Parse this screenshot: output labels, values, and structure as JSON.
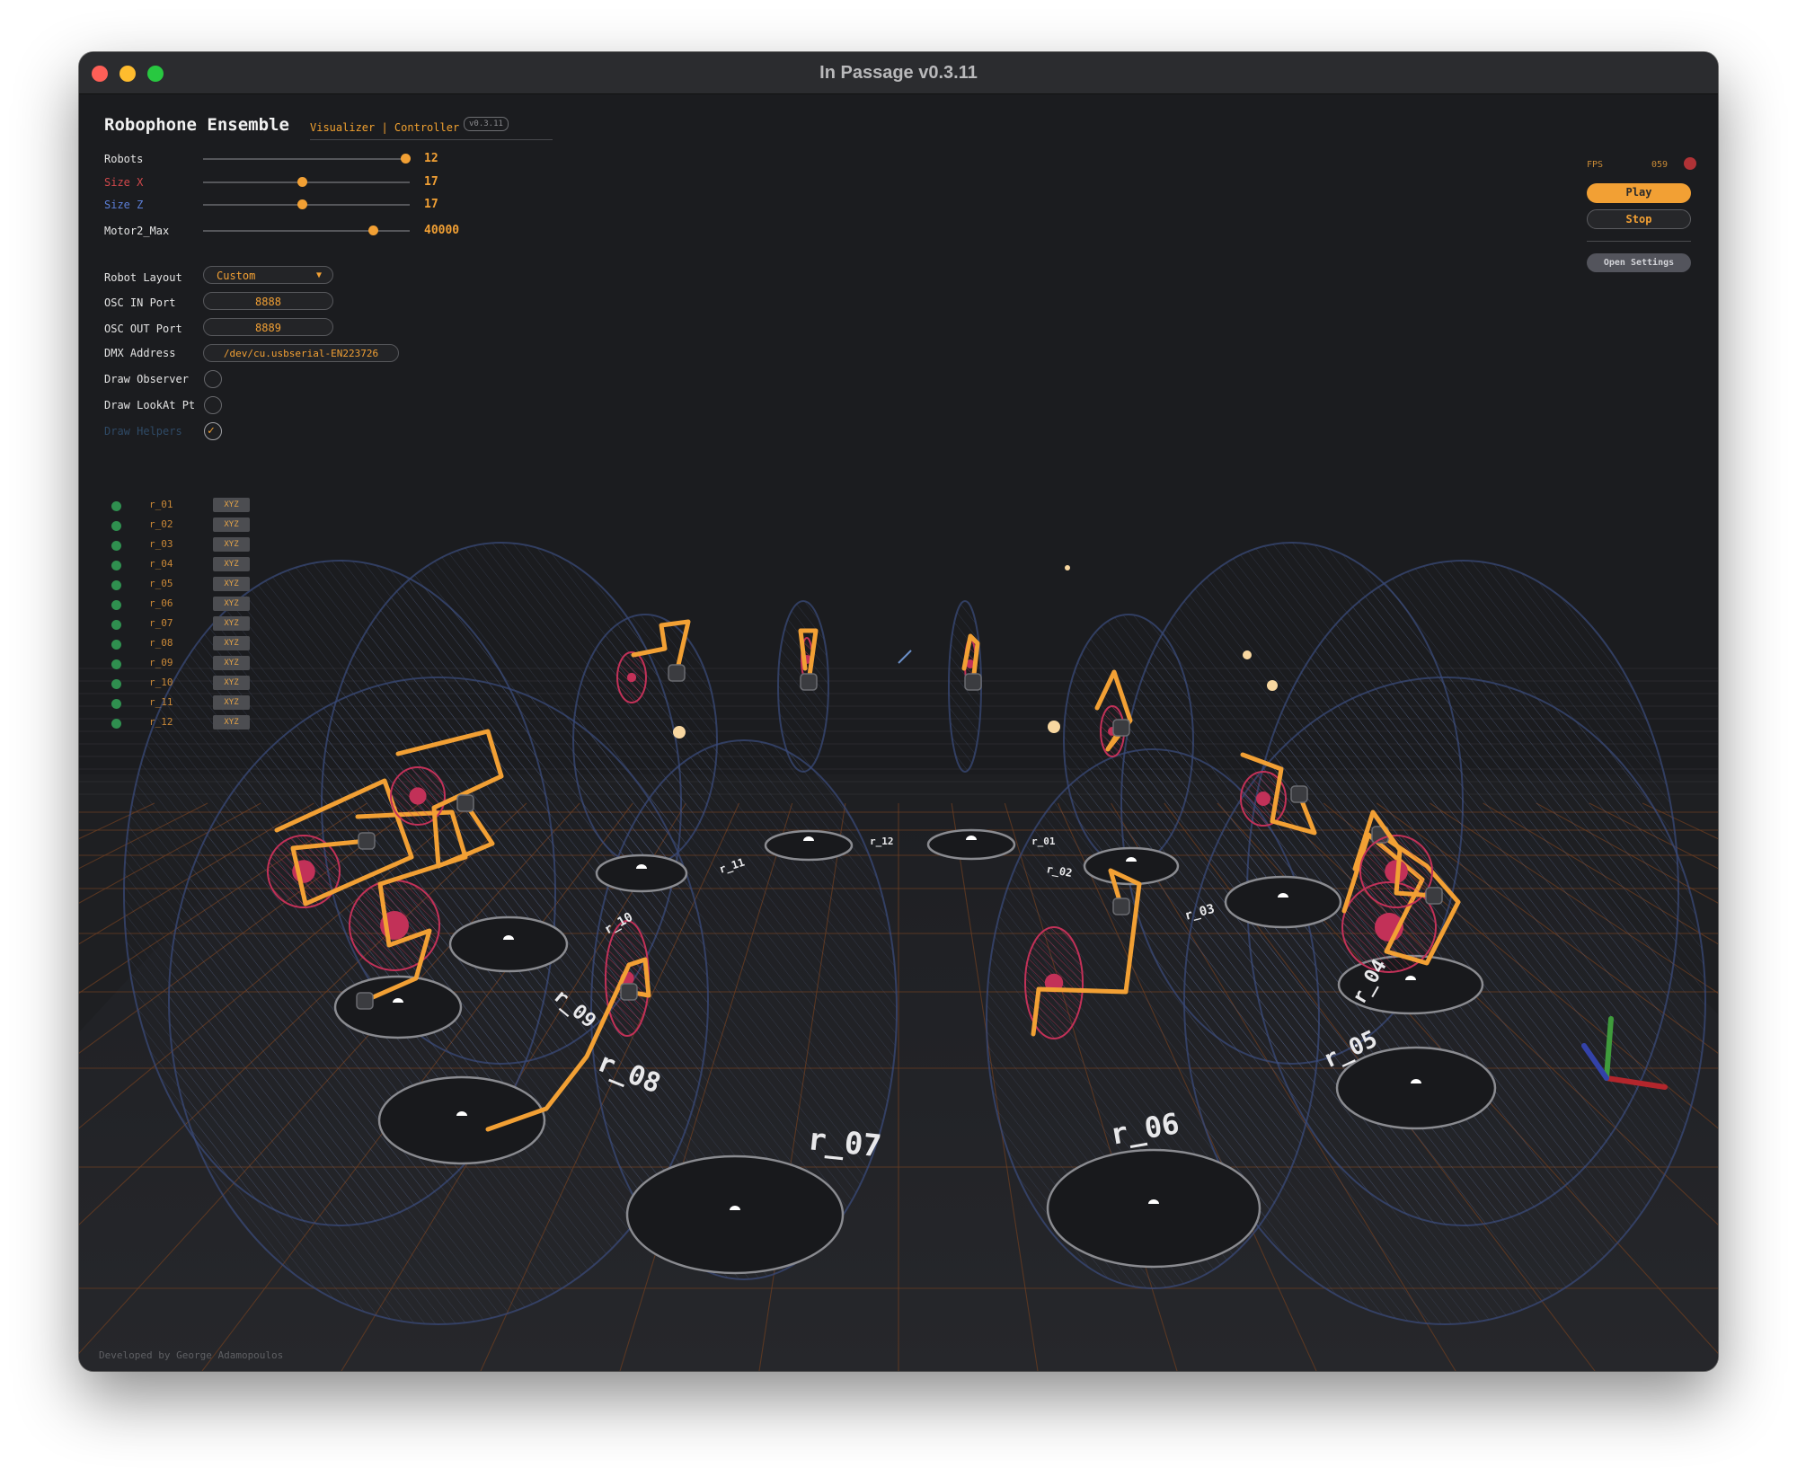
{
  "window": {
    "title": "In Passage v0.3.11"
  },
  "panel": {
    "title": "Robophone Ensemble",
    "subtitle": "Visualizer | Controller",
    "version": "v0.3.11",
    "sliders": [
      {
        "label": "Robots",
        "value": "12",
        "fraction": 0.98,
        "label_color": "#e4e4e4"
      },
      {
        "label": "Size X",
        "value": "17",
        "fraction": 0.48,
        "label_color": "#d0484b"
      },
      {
        "label": "Size Z",
        "value": "17",
        "fraction": 0.48,
        "label_color": "#5c7fd8"
      },
      {
        "label": "Motor2_Max",
        "value": "40000",
        "fraction": 0.82,
        "label_color": "#e4e4e4"
      }
    ],
    "layout": {
      "label": "Robot Layout",
      "value": "Custom"
    },
    "osc_in": {
      "label": "OSC IN Port",
      "value": "8888"
    },
    "osc_out": {
      "label": "OSC OUT Port",
      "value": "8889"
    },
    "dmx": {
      "label": "DMX Address",
      "value": "/dev/cu.usbserial-EN223726"
    },
    "toggles": [
      {
        "label": "Draw Observer",
        "checked": false,
        "label_color": "#e4e4e4"
      },
      {
        "label": "Draw LookAt Pt",
        "checked": false,
        "label_color": "#e4e4e4"
      },
      {
        "label": "Draw Helpers",
        "checked": true,
        "label_color": "#2f4a66"
      }
    ]
  },
  "robots": {
    "button_label": "XYZ",
    "status_color": "#2f8f4f",
    "items": [
      "r_01",
      "r_02",
      "r_03",
      "r_04",
      "r_05",
      "r_06",
      "r_07",
      "r_08",
      "r_09",
      "r_10",
      "r_11",
      "r_12"
    ]
  },
  "hud": {
    "fps_label": "FPS",
    "fps_value": "059",
    "play_label": "Play",
    "stop_label": "Stop",
    "settings_label": "Open Settings"
  },
  "scene": {
    "labels": [
      "r_08",
      "r_07",
      "r_06",
      "r_05",
      "r_09",
      "r_04",
      "r_10",
      "r_03",
      "r_11",
      "r_02",
      "r_12",
      "r_01"
    ],
    "arm_color": "#f2a034",
    "disc_color": "#c23158",
    "sphere_color": "#3a4a78"
  },
  "footer": {
    "text": "Developed by George Adamopoulos"
  }
}
